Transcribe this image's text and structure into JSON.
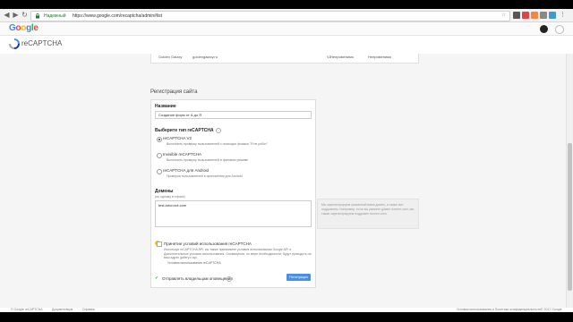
{
  "browser": {
    "secure_label": "Надежный",
    "url": "https://www.google.com/recaptcha/admin#list"
  },
  "google_logo": "Google",
  "header": {
    "title": "reCAPTCHA"
  },
  "site_row": {
    "name": "Golden Galaxy",
    "domain": "goldengalaxy.ru",
    "version": "V2",
    "col1": "Неприменимо",
    "col2": "Неприменимо"
  },
  "form": {
    "heading": "Регистрация сайта",
    "name_label": "Название",
    "name_value": "Создание форм от А до Я",
    "type_label": "Выберите тип reCAPTCHA",
    "options": [
      {
        "label": "reCAPTCHA V2",
        "desc": "Выполнить проверку пользователей с помощью флажка \"Я не робот\"",
        "selected": true
      },
      {
        "label": "Invisible reCAPTCHA",
        "desc": "Выполнить проверку пользователей в фоновом режиме",
        "selected": false
      },
      {
        "label": "reCAPTCHA для Android",
        "desc": "Проверка пользователей в приложении для Android",
        "selected": false
      }
    ],
    "domains_label": "Домены",
    "domains_sub": "(по одному в строке)",
    "domains_value": "test.artcrorot.com",
    "hint": "Мы зарегистрируем указанный вами домен, а также все поддомены. Например, если вы укажете домен domen.com, мы также зарегистрируем поддомен domen.com.",
    "tos_label": "Принятие условий использования reCAPTCHA",
    "tos_text": "Используя reCAPTCHA API, вы также принимаете условия использования Google API и Дополнительные условия использования. Оповещения, по мере необходимости, будут приходить на ваш адрес gallery.c.api.",
    "tos_link": "Условия использования reCAPTCHA",
    "alerts_label": "Отправлять владельцам оповещения",
    "submit": "Регистрация"
  },
  "footer": {
    "links": [
      "© Google reCAPTCHA",
      "Документация",
      "Справка"
    ],
    "right": [
      "Условия использования и Политика конфиденциальности",
      "© 2017 Google"
    ]
  }
}
